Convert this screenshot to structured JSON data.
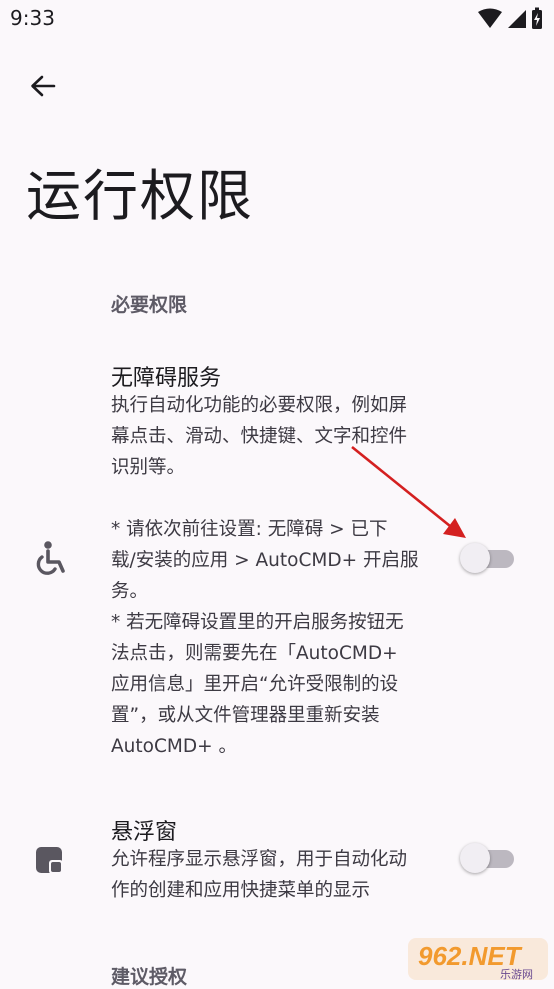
{
  "status_bar": {
    "time": "9:33"
  },
  "page": {
    "title": "运行权限"
  },
  "sections": [
    {
      "header": "必要权限"
    },
    {
      "header": "建议授权"
    }
  ],
  "accessibility": {
    "title": "无障碍服务",
    "summary": "执行自动化功能的必要权限，例如屏\n幕点击、滑动、快捷键、文字和控件\n识别等。\n\n* 请依次前往设置: 无障碍 > 已下\n载/安装的应用 > AutoCMD+ 开启服\n务。\n* 若无障碍设置里的开启服务按钮无\n法点击，则需要先在「AutoCMD+\n应用信息」里开启“允许受限制的设\n置”，或从文件管理器里重新安装\nAutoCMD+ 。",
    "enabled": false,
    "icon": "accessibility-icon"
  },
  "overlay": {
    "title": "悬浮窗",
    "summary": "允许程序显示悬浮窗，用于自动化动\n作的创建和应用快捷菜单的显示",
    "enabled": false,
    "icon": "floating-window-icon"
  },
  "watermark": {
    "text": "962.NET",
    "subtext": "乐游网"
  },
  "colors": {
    "background": "#fbf8fb",
    "arrow": "#d42020",
    "switch_track_off": "#bcb8c0"
  }
}
